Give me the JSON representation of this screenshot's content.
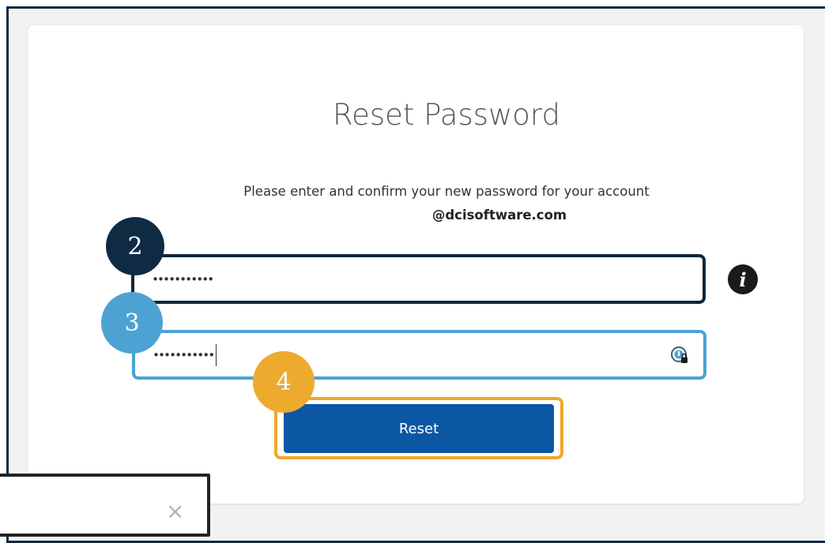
{
  "page": {
    "title": "Reset Password",
    "instructions": "Please enter and confirm your new password for your account",
    "account_email": "@dcisoftware.com"
  },
  "form": {
    "new_password_value": "•••••••••••",
    "confirm_password_value": "•••••••••••",
    "reset_label": "Reset"
  },
  "callouts": {
    "step_2": "2",
    "step_3": "3",
    "step_4": "4"
  },
  "popup": {
    "close_glyph": "×"
  },
  "icons": {
    "info": "info-icon",
    "password_manager": "password-manager-lock-icon",
    "close": "close-icon"
  },
  "colors": {
    "primary_button": "#0b57a4",
    "step_2": "#0f2b44",
    "step_3": "#4da2d4",
    "step_4": "#ecab2f",
    "frame_border": "#0f2b44"
  }
}
